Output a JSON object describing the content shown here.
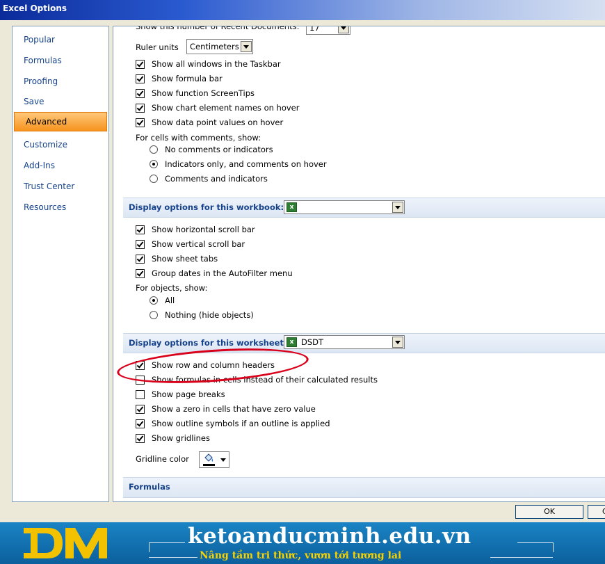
{
  "window": {
    "title": "Excel Options"
  },
  "sidebar": {
    "items": [
      {
        "label": "Popular"
      },
      {
        "label": "Formulas"
      },
      {
        "label": "Proofing"
      },
      {
        "label": "Save"
      },
      {
        "label": "Advanced",
        "selected": true
      },
      {
        "label": "Customize"
      },
      {
        "label": "Add-Ins"
      },
      {
        "label": "Trust Center"
      },
      {
        "label": "Resources"
      }
    ]
  },
  "display": {
    "recent_docs_label": "Show this number of Recent Documents:",
    "recent_docs_value": "17",
    "ruler_label": "Ruler units",
    "ruler_value": "Centimeters",
    "checks": [
      {
        "label": "Show all windows in the Taskbar",
        "checked": true
      },
      {
        "label": "Show formula bar",
        "checked": true
      },
      {
        "label": "Show function ScreenTips",
        "checked": true
      },
      {
        "label": "Show chart element names on hover",
        "checked": true
      },
      {
        "label": "Show data point values on hover",
        "checked": true
      }
    ],
    "comments_label": "For cells with comments, show:",
    "comments_options": [
      {
        "label": "No comments or indicators",
        "selected": false
      },
      {
        "label": "Indicators only, and comments on hover",
        "selected": true
      },
      {
        "label": "Comments and indicators",
        "selected": false
      }
    ]
  },
  "workbook": {
    "header": "Display options for this workbook:",
    "selected": "",
    "checks": [
      {
        "label": "Show horizontal scroll bar",
        "checked": true
      },
      {
        "label": "Show vertical scroll bar",
        "checked": true
      },
      {
        "label": "Show sheet tabs",
        "checked": true
      },
      {
        "label": "Group dates in the AutoFilter menu",
        "checked": true
      }
    ],
    "objects_label": "For objects, show:",
    "objects_options": [
      {
        "label": "All",
        "selected": true
      },
      {
        "label": "Nothing (hide objects)",
        "selected": false
      }
    ]
  },
  "worksheet": {
    "header": "Display options for this worksheet:",
    "selected": "DSDT",
    "checks": [
      {
        "label": "Show row and column headers",
        "checked": true
      },
      {
        "label": "Show formulas in cells instead of their calculated results",
        "checked": false
      },
      {
        "label": "Show page breaks",
        "checked": false
      },
      {
        "label": "Show a zero in cells that have zero value",
        "checked": true
      },
      {
        "label": "Show outline symbols if an outline is applied",
        "checked": true
      },
      {
        "label": "Show gridlines",
        "checked": true
      }
    ],
    "gridline_label": "Gridline color"
  },
  "formulas": {
    "header": "Formulas"
  },
  "buttons": {
    "ok": "OK",
    "cancel": "Cancel"
  },
  "banner": {
    "site": "ketoanducminh.edu.vn",
    "tagline": "Nâng tầm tri thức, vươn tới tương lai"
  },
  "colors": {
    "accent": "#f7931e",
    "header_text": "#15428b",
    "highlight": "#d9001b",
    "banner": "#1a84c4"
  }
}
